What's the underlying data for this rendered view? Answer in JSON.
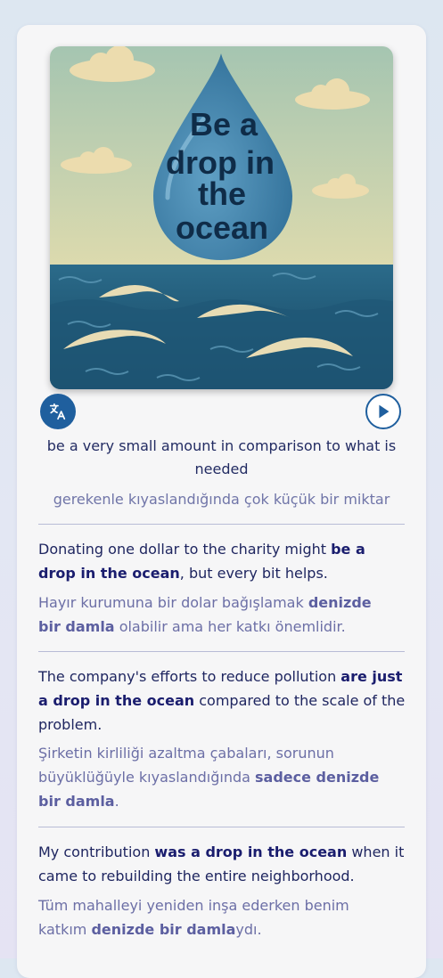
{
  "image_text": [
    "Be a",
    "drop in",
    "the",
    "ocean"
  ],
  "controls": {
    "translate_icon": "translate-icon",
    "play_icon": "play-icon"
  },
  "definition": {
    "en": "be a very small amount in comparison to what is needed",
    "tr": "gerekenle kıyaslandığında çok küçük bir miktar"
  },
  "examples": [
    {
      "en_before": "Donating one dollar to the charity might ",
      "en_phrase": "be a drop in the ocean",
      "en_after": ", but every bit helps.",
      "tr_before": "Hayır kurumuna bir dolar bağışlamak ",
      "tr_phrase": "denizde bir damla",
      "tr_after": " olabilir ama her katkı önemlidir."
    },
    {
      "en_before": "The company's efforts to reduce pollution ",
      "en_phrase": "are just a drop in the ocean",
      "en_after": " compared to the scale of the problem.",
      "tr_before": "Şirketin kirliliği azaltma çabaları, sorunun büyüklüğüyle kıyaslandığında ",
      "tr_phrase": "sadece denizde bir damla",
      "tr_after": "."
    },
    {
      "en_before": "My contribution ",
      "en_phrase": "was a drop in the ocean",
      "en_after": " when it came to rebuilding the entire neighborhood.",
      "tr_before": "Tüm mahalleyi yeniden inşa ederken benim katkım ",
      "tr_phrase": "denizde bir damla",
      "tr_after": "ydı."
    }
  ],
  "colors": {
    "primary": "#1f5f9e",
    "text": "#232c63",
    "translation": "#7075a8",
    "divider": "#b8bcd6"
  }
}
